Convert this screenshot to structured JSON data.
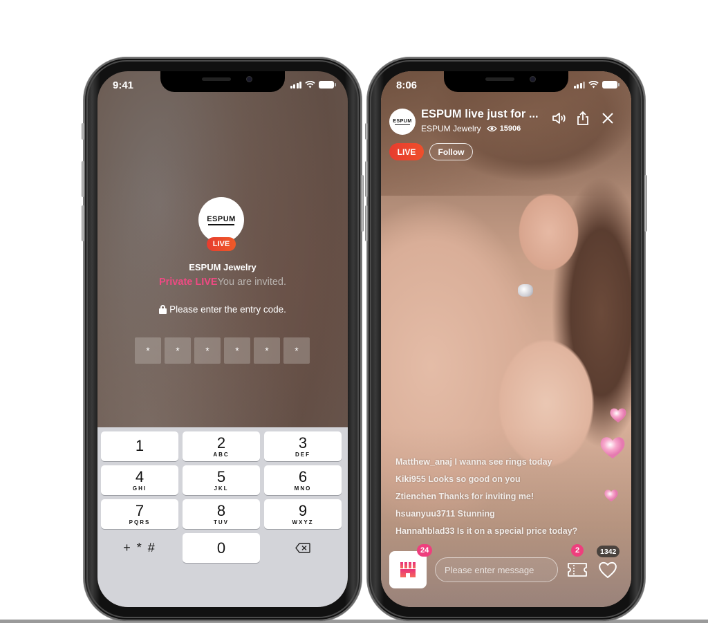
{
  "left_phone": {
    "status_bar": {
      "time": "9:41"
    },
    "brand": {
      "logo_text": "ESPUM",
      "name": "ESPUM Jewelry",
      "live_badge": "LIVE"
    },
    "invite": {
      "highlight": "Private LIVE",
      "text": "You are invited."
    },
    "entry_prompt": "Please enter the entry code.",
    "code_boxes": [
      "*",
      "*",
      "*",
      "*",
      "*",
      "*"
    ],
    "keypad": {
      "keys": [
        {
          "digit": "1",
          "letters": ""
        },
        {
          "digit": "2",
          "letters": "ABC"
        },
        {
          "digit": "3",
          "letters": "DEF"
        },
        {
          "digit": "4",
          "letters": "GHI"
        },
        {
          "digit": "5",
          "letters": "JKL"
        },
        {
          "digit": "6",
          "letters": "MNO"
        },
        {
          "digit": "7",
          "letters": "PQRS"
        },
        {
          "digit": "8",
          "letters": "TUV"
        },
        {
          "digit": "9",
          "letters": "WXYZ"
        },
        {
          "digit": "0",
          "letters": ""
        }
      ],
      "symbols_key": "+ * #",
      "backspace_icon": "backspace-icon"
    }
  },
  "right_phone": {
    "status_bar": {
      "time": "8:06"
    },
    "header": {
      "logo_text": "ESPUM",
      "title": "ESPUM live just for ...",
      "channel": "ESPUM Jewelry",
      "view_count": "15906",
      "icons": [
        "speaker-icon",
        "share-icon",
        "close-icon"
      ]
    },
    "live_badge": "LIVE",
    "follow_label": "Follow",
    "chat": [
      {
        "user": "Matthew_anaj",
        "message": "I wanna see rings today"
      },
      {
        "user": "Kiki955",
        "message": "Looks so good on you"
      },
      {
        "user": "Ztienchen",
        "message": "Thanks for inviting me!"
      },
      {
        "user": "hsuanyuu3711",
        "message": "Stunning"
      },
      {
        "user": "Hannahblad33",
        "message": "Is it on a special price today?"
      }
    ],
    "bottom_bar": {
      "shop_badge": "24",
      "message_placeholder": "Please enter message",
      "coupon_badge": "2",
      "like_count": "1342"
    }
  },
  "colors": {
    "live_red": "#e63c2f",
    "accent_pink": "#ef4a83",
    "badge_pink": "#ee3f7d",
    "keypad_bg": "#d3d4d9"
  }
}
